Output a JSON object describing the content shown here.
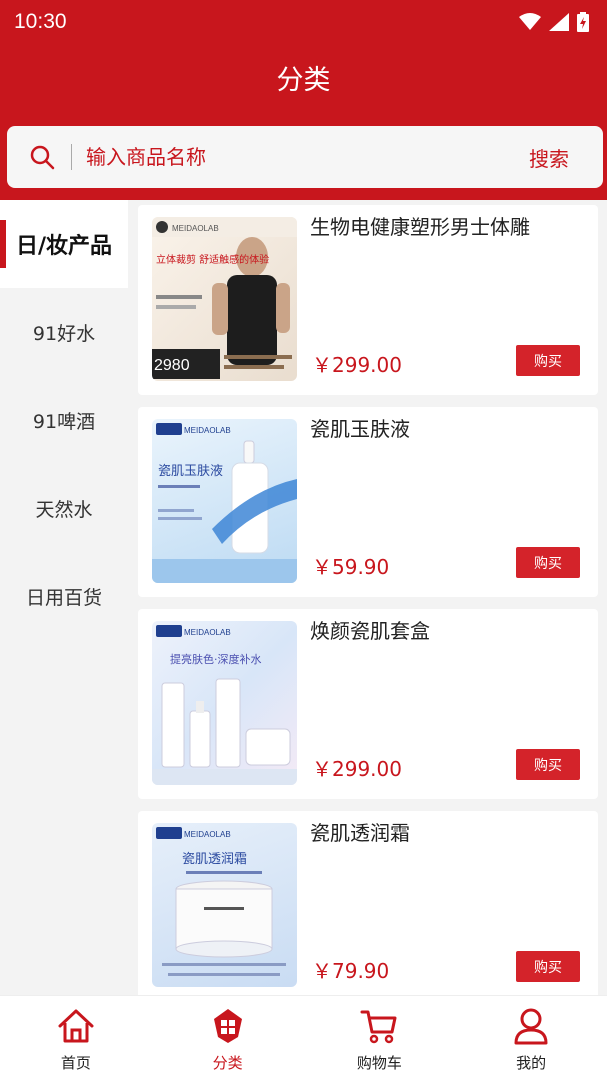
{
  "status": {
    "time": "10:30"
  },
  "header": {
    "title": "分类"
  },
  "search": {
    "placeholder": "输入商品名称",
    "button": "搜索"
  },
  "categories": [
    {
      "label": "日/妆产品",
      "active": true
    },
    {
      "label": "91好水"
    },
    {
      "label": "91啤酒"
    },
    {
      "label": "天然水"
    },
    {
      "label": "日用百货"
    }
  ],
  "products": [
    {
      "name": "生物电健康塑形男士体雕",
      "price": "￥299.00",
      "buy": "购买",
      "thumb": {
        "brand": "MEIDAOLAB",
        "headline": "立体裁剪 舒适触感的体验",
        "badge": "2980"
      }
    },
    {
      "name": "瓷肌玉肤液",
      "price": "￥59.90",
      "buy": "购买",
      "thumb": {
        "brand": "MEIDAOLAB",
        "headline": "瓷肌玉肤液"
      }
    },
    {
      "name": "焕颜瓷肌套盒",
      "price": "￥299.00",
      "buy": "购买",
      "thumb": {
        "brand": "MEIDAOLAB",
        "headline": "提亮肤色·深度补水"
      }
    },
    {
      "name": "瓷肌透润霜",
      "price": "￥79.90",
      "buy": "购买",
      "thumb": {
        "brand": "MEIDAOLAB",
        "headline": "瓷肌透润霜"
      }
    }
  ],
  "tabbar": [
    {
      "label": "首页",
      "icon": "home-icon"
    },
    {
      "label": "分类",
      "icon": "category-icon",
      "active": true
    },
    {
      "label": "购物车",
      "icon": "cart-icon"
    },
    {
      "label": "我的",
      "icon": "profile-icon"
    }
  ],
  "colors": {
    "primary": "#c8161d",
    "buy_button": "#d4232a"
  }
}
